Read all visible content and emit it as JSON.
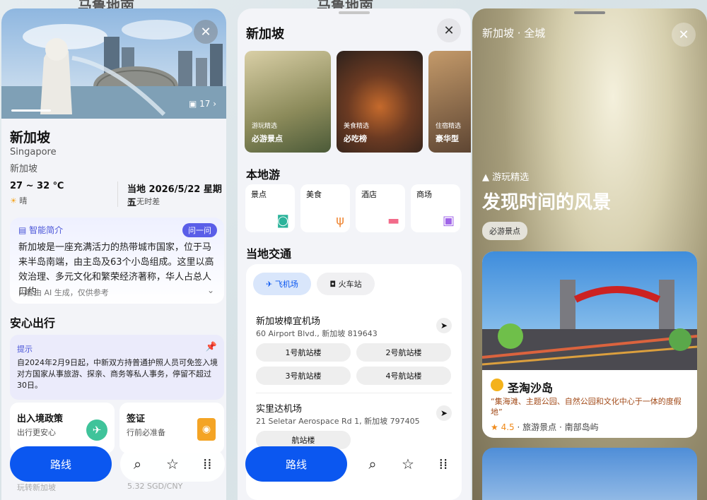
{
  "map_title": "马鲁地南",
  "panel1": {
    "photo_count": "17",
    "title": "新加坡",
    "subtitle_en": "Singapore",
    "subtitle_cn": "新加坡",
    "temp": "27 ~ 32 ℃",
    "condition": "晴",
    "local_time": "当地 2026/5/22 星期五",
    "time_diff": "无时差",
    "intro_label": "智能简介",
    "ask_label": "问一问",
    "intro_text": "新加坡是一座充满活力的热带城市国家，位于马来半岛南端，由主岛及63个小岛组成。这里以高效治理、多元文化和繁荣经济著称，华人占总人口约",
    "intro_footer": "内容由 AI 生成，仅供参考",
    "section_safe": "安心出行",
    "tip_label": "提示",
    "tip_text": "自2024年2月9日起，中新双方持普通护照人员可免签入境对方国家从事旅游、探亲、商务等私人事务，停留不超过30日。",
    "card_entry_title": "出入境政策",
    "card_entry_sub": "出行更安心",
    "card_visa_title": "签证",
    "card_visa_sub": "行前必准备",
    "faded_left": "玩转新加坡",
    "faded_right": "5.32 SGD/CNY",
    "route_label": "路线"
  },
  "panel2": {
    "title": "新加坡",
    "features": [
      {
        "tag": "游玩精选",
        "name": "必游景点"
      },
      {
        "tag": "美食精选",
        "name": "必吃榜"
      },
      {
        "tag": "住宿精选",
        "name": "豪华型"
      }
    ],
    "section_local": "本地游",
    "categories": [
      "景点",
      "美食",
      "酒店",
      "商场"
    ],
    "section_transport": "当地交通",
    "mode_airport": "飞机场",
    "mode_train": "火车站",
    "airport1_name": "新加坡樟宜机场",
    "airport1_addr": "60 Airport Blvd., 新加坡 819643",
    "terminals": [
      "1号航站楼",
      "2号航站楼",
      "3号航站楼",
      "4号航站楼"
    ],
    "airport2_name": "实里达机场",
    "airport2_addr": "21 Seletar Aerospace Rd 1, 新加坡 797405",
    "airport2_terminal": "航站楼",
    "route_label": "路线"
  },
  "panel3": {
    "header": "新加坡 · 全城",
    "tag": "游玩精选",
    "title": "发现时间的风景",
    "chip": "必游景点",
    "spot_name": "圣淘沙岛",
    "spot_desc": "“集海滩、主题公园、自然公园和文化中心于一体的度假地”",
    "rating": "4.5",
    "meta": "旅游景点 · 南部岛屿"
  }
}
